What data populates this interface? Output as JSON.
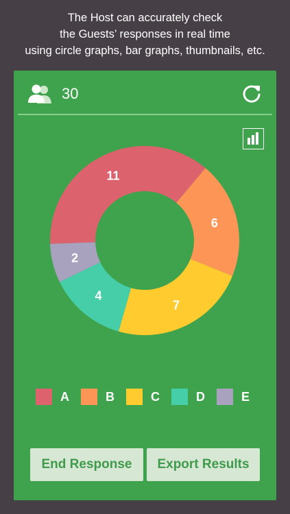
{
  "caption": {
    "lines": [
      "The Host can accurately check",
      "the Guests’ responses in real time",
      "using circle graphs, bar graphs, thumbnails, etc."
    ]
  },
  "header": {
    "participants_icon": "users-icon",
    "participant_count": "30",
    "refresh_icon": "refresh-icon"
  },
  "view_toggle_icon": "bar-chart-icon",
  "colors": {
    "background": "#463f45",
    "panel": "#3fa34d",
    "divider": "#87cf8f",
    "button_bg": "#d6e8d4",
    "button_text": "#3f9a4b"
  },
  "chart_data": {
    "type": "pie",
    "variant": "donut",
    "categories": [
      "A",
      "B",
      "C",
      "D",
      "E"
    ],
    "values": [
      11,
      6,
      7,
      4,
      2
    ],
    "colors": [
      "#dc626d",
      "#fd9556",
      "#ffcb2f",
      "#45cea8",
      "#a8a2bf"
    ],
    "legend_position": "bottom"
  },
  "buttons": {
    "end_response": "End Response",
    "export_results": "Export Results"
  }
}
